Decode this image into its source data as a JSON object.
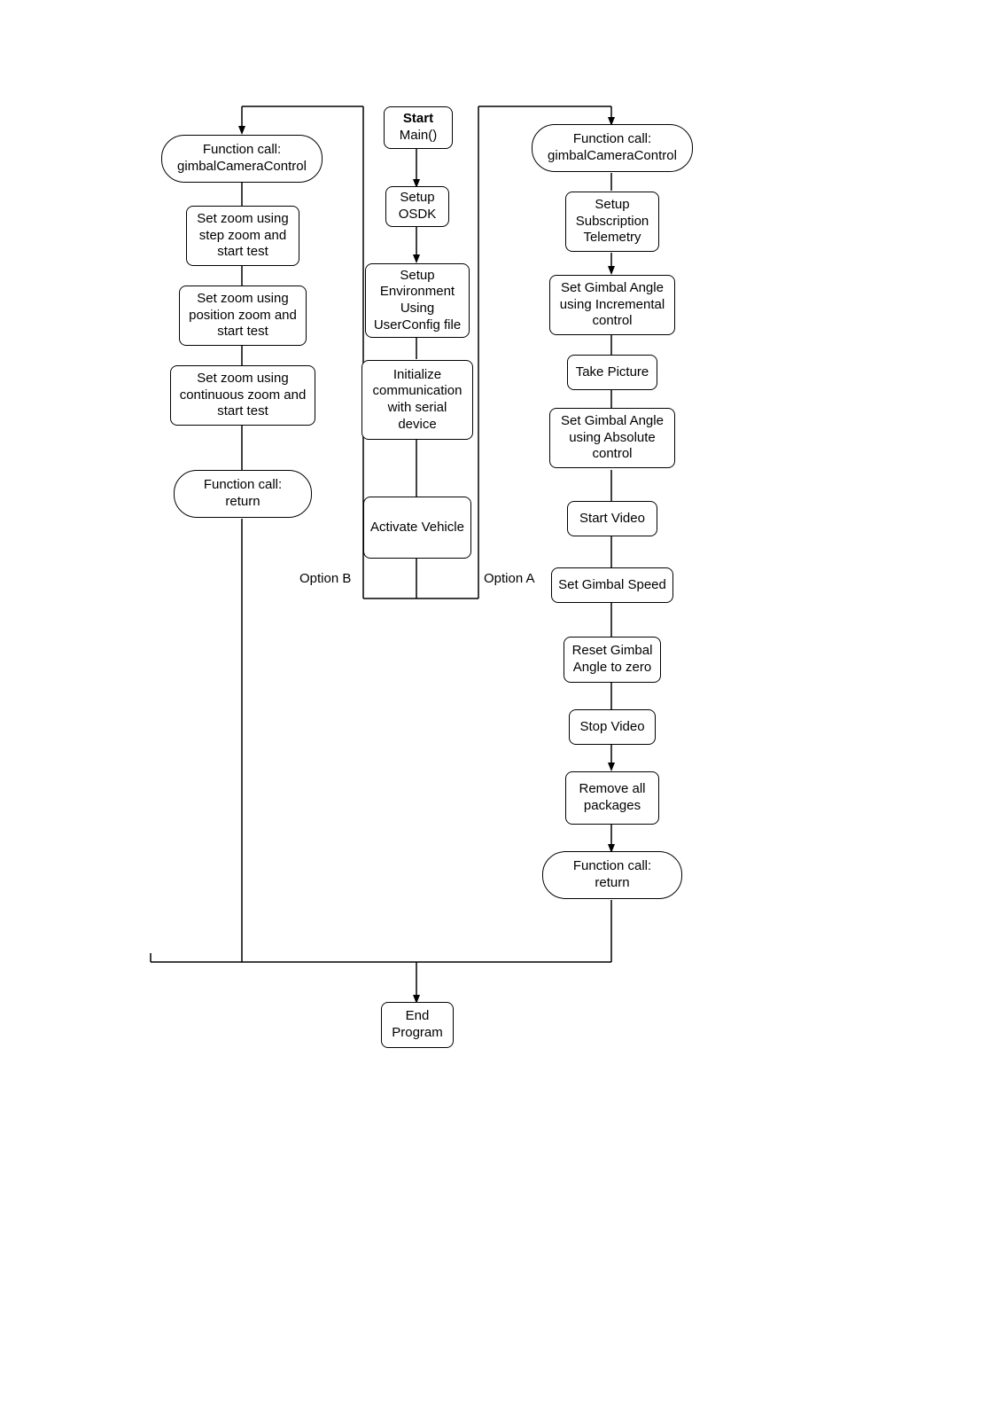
{
  "diagram": {
    "center": {
      "start_bold": "Start",
      "start_sub": "Main()",
      "setup_osdk": "Setup\nOSDK",
      "setup_env": "Setup\nEnvironment\nUsing\nUserConfig file",
      "init_comm": "Initialize\ncommunication\nwith serial\ndevice",
      "activate": "Activate Vehicle",
      "end": "End\nProgram"
    },
    "left": {
      "fc": "Function call:\ngimbalCameraControl",
      "step_zoom": "Set zoom using\nstep zoom and\nstart test",
      "pos_zoom": "Set zoom using\nposition zoom and\nstart test",
      "cont_zoom": "Set zoom using\ncontinuous zoom and\nstart test",
      "ret": "Function call:\nreturn"
    },
    "right": {
      "fc": "Function call:\ngimbalCameraControl",
      "telemetry": "Setup\nSubscription\nTelemetry",
      "gimbal_inc": "Set Gimbal Angle\nusing Incremental\ncontrol",
      "take_pic": "Take Picture",
      "gimbal_abs": "Set Gimbal Angle\nusing Absolute\ncontrol",
      "start_video": "Start Video",
      "gimbal_speed": "Set Gimbal Speed",
      "reset_gimbal": "Reset Gimbal\nAngle to zero",
      "stop_video": "Stop Video",
      "remove_pkg": "Remove all\npackages",
      "ret": "Function call:\nreturn"
    },
    "labels": {
      "option_a": "Option A",
      "option_b": "Option B"
    }
  }
}
